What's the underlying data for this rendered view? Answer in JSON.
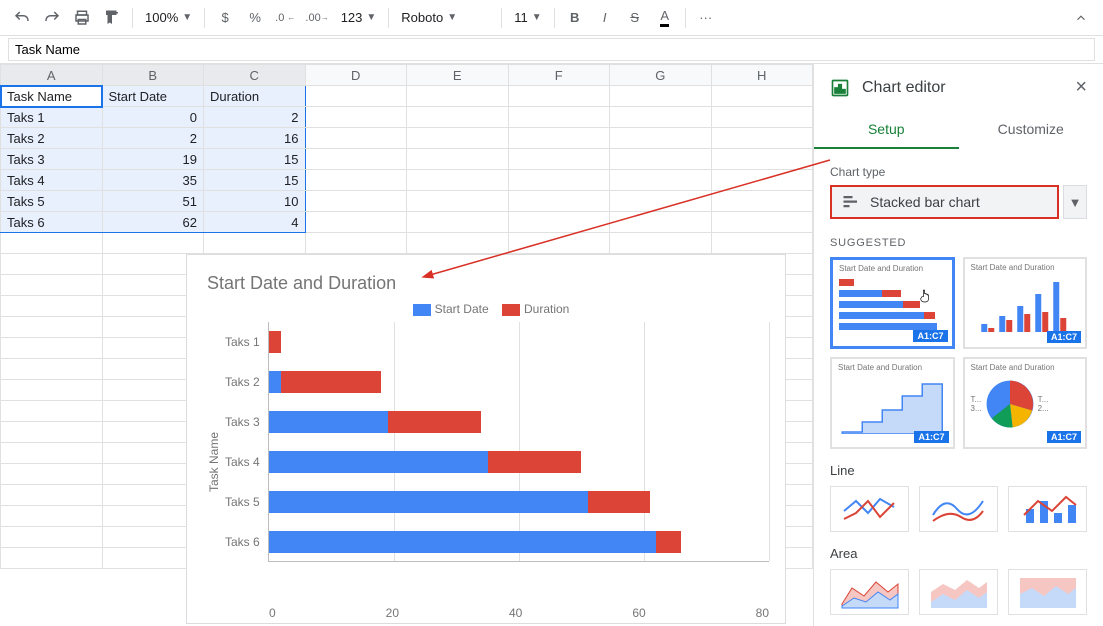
{
  "toolbar": {
    "zoom": "100%",
    "format_group": [
      "$",
      "%",
      ".0",
      ".00",
      "123"
    ],
    "font": "Roboto",
    "font_size": "11",
    "more": "···"
  },
  "formula_bar": {
    "value": "Task Name"
  },
  "columns": [
    "A",
    "B",
    "C",
    "D",
    "E",
    "F",
    "G",
    "H"
  ],
  "headers": {
    "a": "Task Name",
    "b": "Start Date",
    "c": "Duration"
  },
  "rows": [
    {
      "name": "Taks 1",
      "start": 0,
      "dur": 2
    },
    {
      "name": "Taks 2",
      "start": 2,
      "dur": 16
    },
    {
      "name": "Taks 3",
      "start": 19,
      "dur": 15
    },
    {
      "name": "Taks 4",
      "start": 35,
      "dur": 15
    },
    {
      "name": "Taks 5",
      "start": 51,
      "dur": 10
    },
    {
      "name": "Taks 6",
      "start": 62,
      "dur": 4
    }
  ],
  "chart_data": {
    "type": "bar",
    "orientation": "horizontal",
    "stacked": true,
    "title": "Start Date and Duration",
    "ylabel": "Task Name",
    "categories": [
      "Taks 1",
      "Taks 2",
      "Taks 3",
      "Taks 4",
      "Taks 5",
      "Taks 6"
    ],
    "series": [
      {
        "name": "Start Date",
        "color": "#4285f4",
        "values": [
          0,
          2,
          19,
          35,
          51,
          62
        ]
      },
      {
        "name": "Duration",
        "color": "#db4437",
        "values": [
          2,
          16,
          15,
          15,
          10,
          4
        ]
      }
    ],
    "xlim": [
      0,
      80
    ],
    "xticks": [
      0,
      20,
      40,
      60,
      80
    ]
  },
  "editor": {
    "title": "Chart editor",
    "tabs": {
      "setup": "Setup",
      "customize": "Customize"
    },
    "chart_type_label": "Chart type",
    "chart_type_value": "Stacked bar chart",
    "suggested_label": "SUGGESTED",
    "sug_caption": "Start Date and Duration",
    "sug_range": "A1:C7",
    "sug_pie_labels": {
      "t": "T...",
      "t2": "T...",
      "v": "3...",
      "v2": "2..."
    },
    "line_label": "Line",
    "area_label": "Area"
  }
}
